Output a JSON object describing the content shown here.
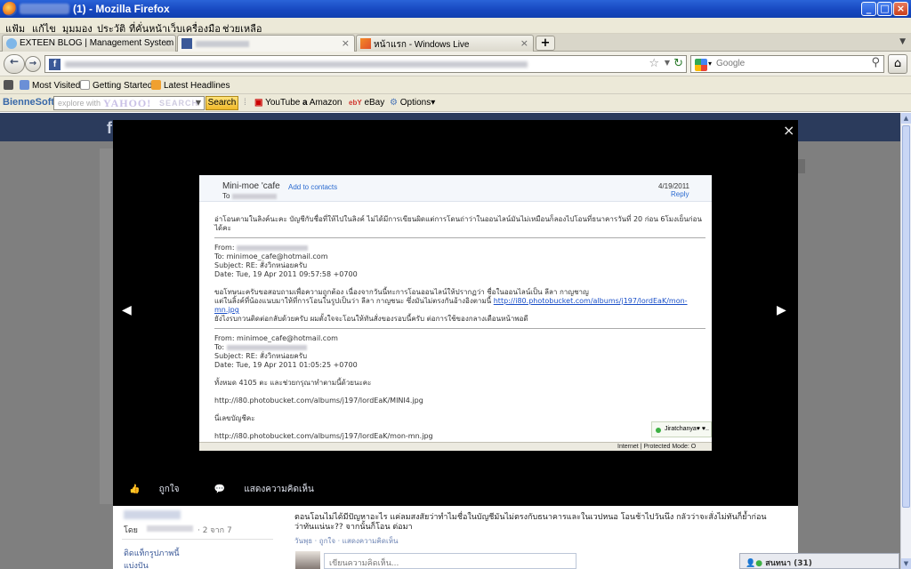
{
  "window": {
    "title": "(1) - Mozilla Firefox",
    "controls": [
      "_",
      "□",
      "×"
    ]
  },
  "menu": [
    "แฟ้ม",
    "แก้ไข",
    "มุมมอง",
    "ประวัติ",
    "ที่คั่นหน้าเว็บ",
    "เครื่องมือ",
    "ช่วยเหลือ"
  ],
  "tabs": [
    {
      "label": "EXTEEN BLOG | Management System",
      "close": "×"
    },
    {
      "label": "",
      "close": "×"
    },
    {
      "label": "หน้าแรก - Windows Live",
      "close": "×"
    }
  ],
  "newtab": "+",
  "nav": {
    "back": "←",
    "forward": "→",
    "url_favicon": "f",
    "search_placeholder": "Google",
    "home": "⌂"
  },
  "bookmarks": [
    "Most Visited",
    "Getting Started",
    "Latest Headlines"
  ],
  "toolbar": {
    "brand": "BienneSoft",
    "search_placeholder": "explore with",
    "yahoo_logo": "YAHOO!",
    "yahoo_search": "SEARCH",
    "search_button": "Search",
    "links": [
      "YouTube",
      "Amazon",
      "eBay",
      "Options"
    ]
  },
  "page": {
    "fb_logo": "f"
  },
  "lightbox": {
    "close": "×",
    "prev": "◀",
    "next": "▶",
    "like": "ถูกใจ",
    "comment": "แสดงความคิดเห็น"
  },
  "email": {
    "sender": "Mini-moe 'cafe",
    "add_contacts": "Add to contacts",
    "to_label": "To",
    "date": "4/19/2011",
    "reply": "Reply",
    "intro": "อ่าโอนตามในลิงค์นะคะ บัญชีกับชื่อที่ให้ไปในลิงค์ ไม่ได้มีการเขียนผิดแต่การโดนถ่าว่าในออนไลน์มันไม่เหมือนก็ลองไปโอนที่ธนาคารวันที่ 20 ก่อน 6โมงเย็นก่อนได้คะ",
    "msg1": {
      "from": "From:",
      "to": "To: minimoe_cafe@hotmail.com",
      "subject": "Subject: RE: สั่งวิกหน่อยครับ",
      "date": "Date: Tue, 19 Apr 2011 09:57:58 +0700"
    },
    "msg1_body1": "ขอโทษนะครับขอสอบถามเพื่อความถูกต้อง เนื่องจากวันนี้ทะการโอนออนไลน์ให้ปรากฏว่า ชื่อในออนไลน์เป็น ลีลา กาญชาญ",
    "msg1_body2_prefix": "แต่ในลิ้งค์ที่น้องแนบมาให้ที่การโอนในรูปเป็นว่า ลีลา กาญชนะ ซึ่งมันไม่ตรงกันอ้างอิงตามนี้",
    "msg1_link": "http://i80.photobucket.com/albums/j197/lordEaK/mon-mn.jpg",
    "msg1_body3": "ยังไงรบกวนติดต่อกลับด้วยครับ ผมตั้งใจจะโอนให้ทันสั่งของรอบนี้ครับ ต่อการใช้ของกลางเดือนหน้าพอดี",
    "msg2": {
      "from": "From: minimoe_cafe@hotmail.com",
      "to": "To:",
      "subject": "Subject: RE: สั่งวิกหน่อยครับ",
      "date": "Date: Tue, 19 Apr 2011 01:05:25 +0700"
    },
    "total": "ทั้งหมด 4105 ตะ และช่วยกรุณาทำตามนี้ด้วยนะคะ",
    "url1": "http://i80.photobucket.com/albums/j197/lordEaK/MINI4.jpg",
    "account": "นี่เลขบัญชีคะ",
    "url2": "http://i80.photobucket.com/albums/j197/lordEaK/mon-mn.jpg",
    "chat": "Jiratchanya♥ ♥..",
    "statusbar": "Internet | Protected Mode: O"
  },
  "comments": {
    "by": "โดย",
    "count": "· 2 จาก 7",
    "tag1": "ติดแท็กรูปภาพนี้",
    "tag2": "แบ่งปัน",
    "text": "ตอนโอนไม่ได้มีปัญหาอะไร แค่ลมสงสัยว่าทำไมชื่อในบัญชีมันไม่ตรงกับธนาคารและในเวปหนอ โอนช้าไปวันนึง กลัวว่าจะสั่งไม่ทันก็ย้ำก่อนว่าทันแน่นะ?? จากนั้นก็โอน ต่อมา",
    "meta": "วันพุธ · ถูกใจ · แสดงความคิดเห็น",
    "input_placeholder": "เขียนความคิดเห็น..."
  },
  "chatbar": "สนทนา (31)"
}
